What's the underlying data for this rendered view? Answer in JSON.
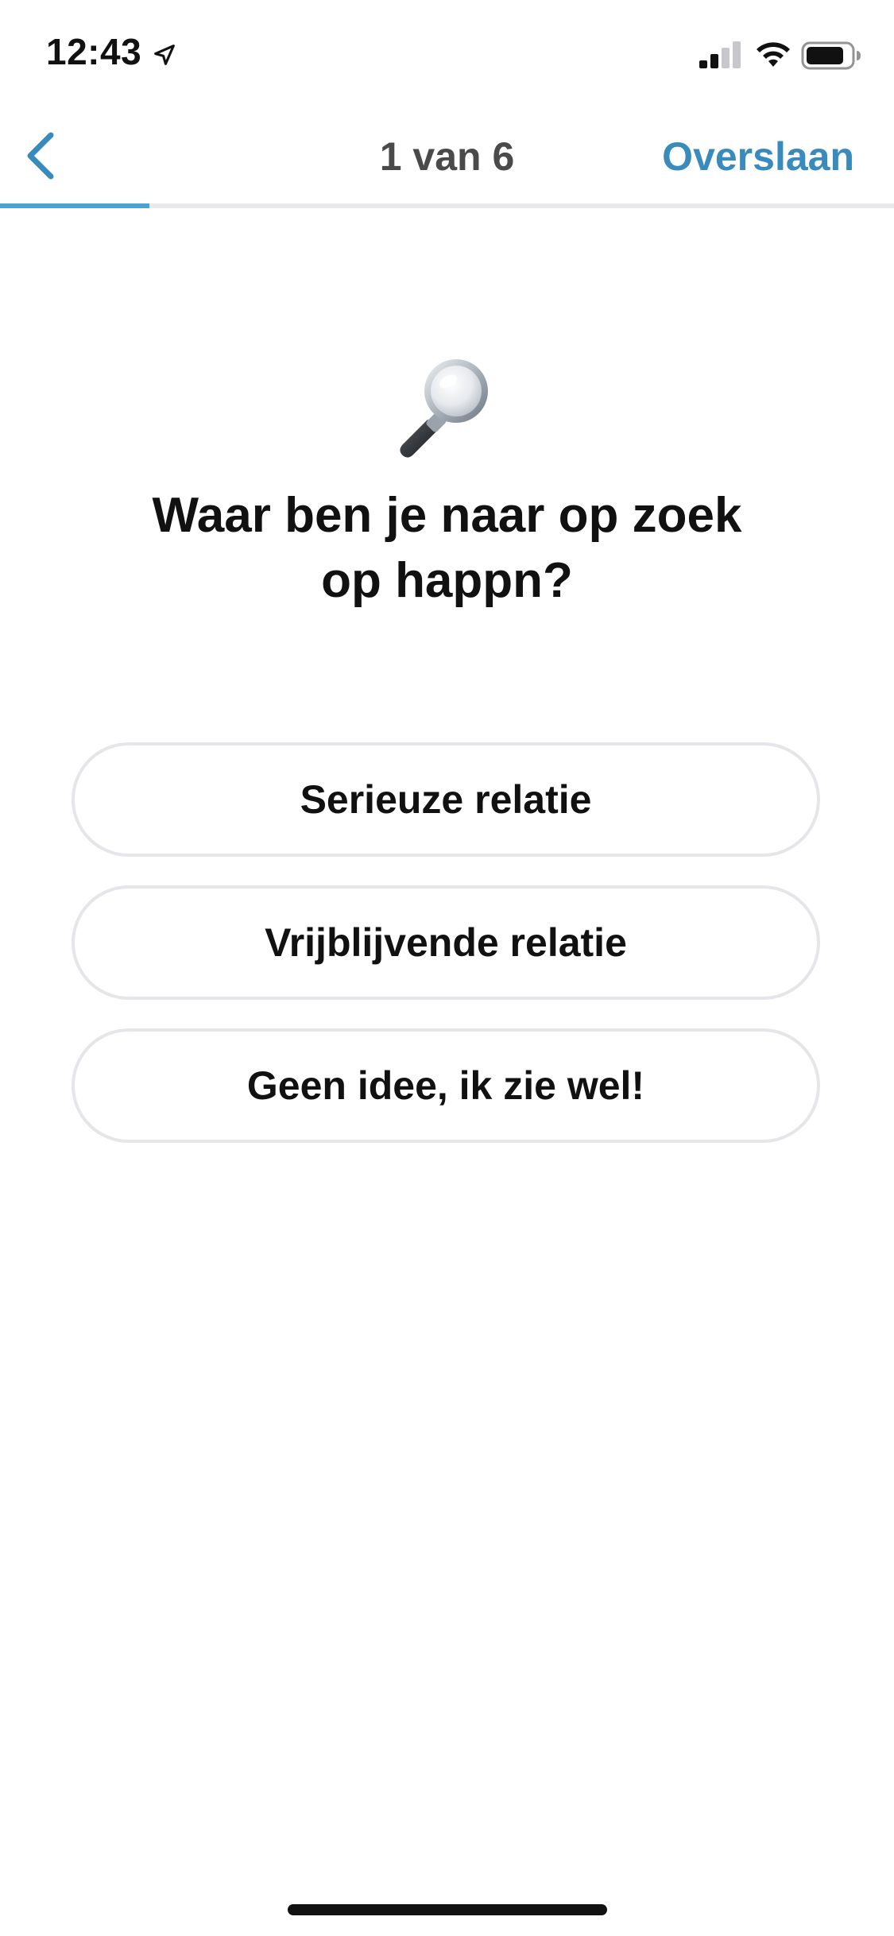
{
  "status_bar": {
    "time": "12:43",
    "icons": [
      "location-arrow-icon",
      "cellular-signal-icon",
      "wifi-icon",
      "battery-icon"
    ]
  },
  "nav": {
    "back_icon": "chevron-left-icon",
    "title": "1 van 6",
    "skip_label": "Overslaan",
    "accent_color": "#3a8bbd"
  },
  "progress": {
    "current_step": 1,
    "total_steps": 6,
    "fill_fraction": 0.1667,
    "fill_color": "#4aa4cf"
  },
  "main": {
    "emoji_icon": "magnifying-glass-icon",
    "question_line1": "Waar ben je naar op zoek",
    "question_line2": "op happn?",
    "options": [
      {
        "label": "Serieuze relatie"
      },
      {
        "label": "Vrijblijvende relatie"
      },
      {
        "label": "Geen idee, ik zie wel!"
      }
    ]
  }
}
